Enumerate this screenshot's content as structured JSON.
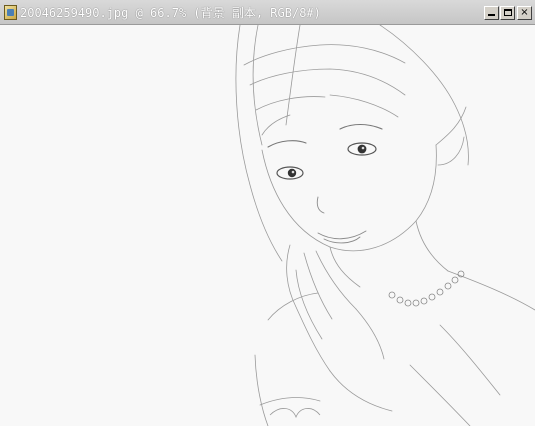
{
  "window": {
    "title": "20046259490.jpg @ 66.7% (背景 副本, RGB/8#)",
    "icon": "photoshop-document-icon",
    "controls": {
      "minimize_icon": "minimize-icon",
      "maximize_icon": "maximize-icon",
      "close_icon": "close-icon",
      "close_glyph": "×"
    }
  },
  "canvas": {
    "image_style": "pencil-sketch portrait",
    "background_color": "#f8f8f8"
  }
}
